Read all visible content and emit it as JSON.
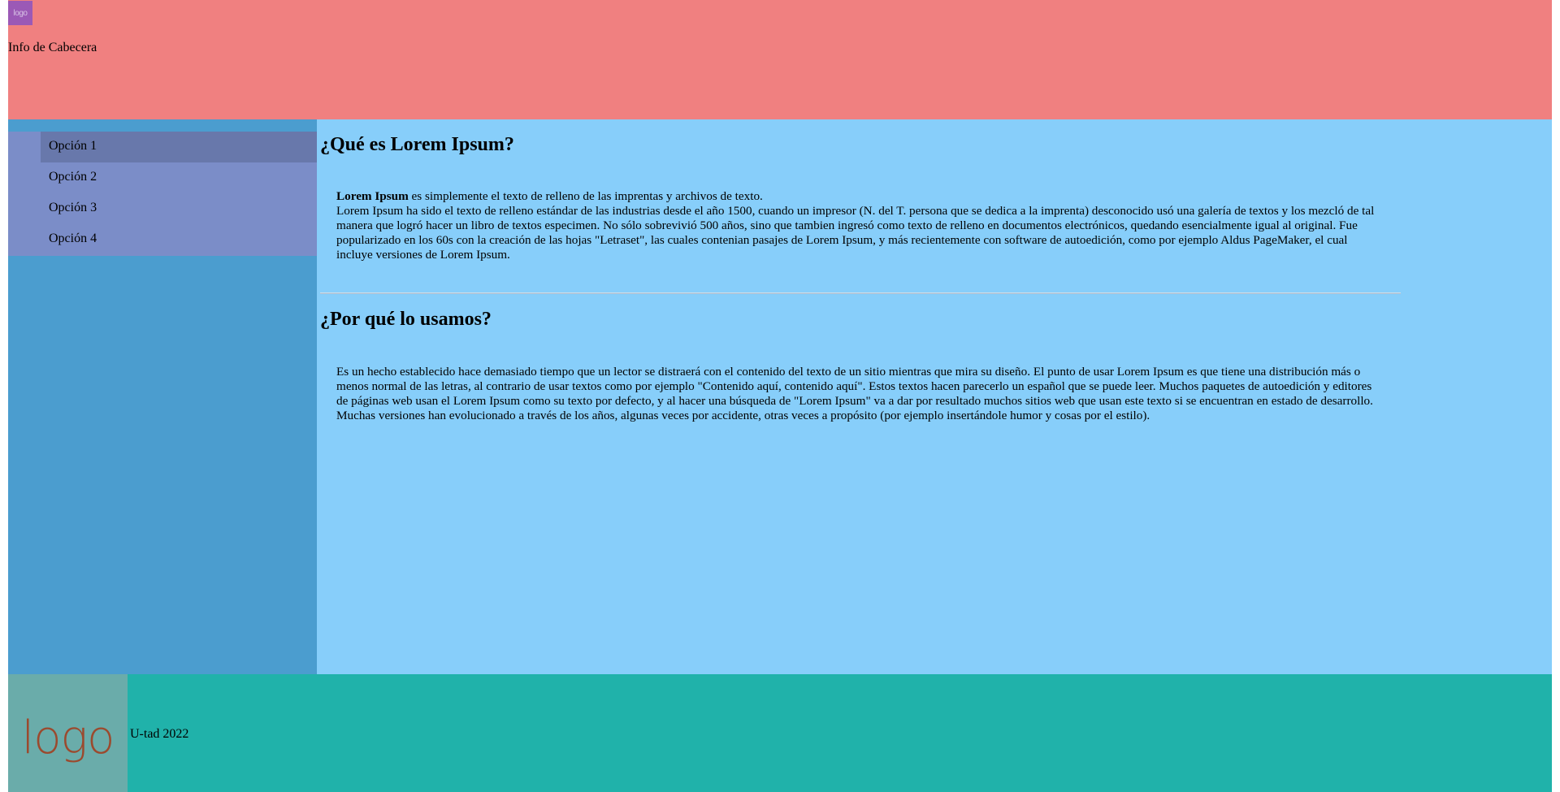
{
  "header": {
    "logo_text": "logo",
    "info": "Info de Cabecera"
  },
  "sidebar": {
    "items": [
      {
        "label": "Opción 1",
        "active": true
      },
      {
        "label": "Opción 2",
        "active": false
      },
      {
        "label": "Opción 3",
        "active": false
      },
      {
        "label": "Opción 4",
        "active": false
      }
    ]
  },
  "main": {
    "section1": {
      "title": "¿Qué es Lorem Ipsum?",
      "lead_bold": "Lorem Ipsum",
      "lead_rest": " es simplemente el texto de relleno de las imprentas y archivos de texto.",
      "body": "Lorem Ipsum ha sido el texto de relleno estándar de las industrias desde el año 1500, cuando un impresor (N. del T. persona que se dedica a la imprenta) desconocido usó una galería de textos y los mezcló de tal manera que logró hacer un libro de textos especimen. No sólo sobrevivió 500 años, sino que tambien ingresó como texto de relleno en documentos electrónicos, quedando esencialmente igual al original. Fue popularizado en los 60s con la creación de las hojas \"Letraset\", las cuales contenian pasajes de Lorem Ipsum, y más recientemente con software de autoedición, como por ejemplo Aldus PageMaker, el cual incluye versiones de Lorem Ipsum."
    },
    "section2": {
      "title": "¿Por qué lo usamos?",
      "body": "Es un hecho establecido hace demasiado tiempo que un lector se distraerá con el contenido del texto de un sitio mientras que mira su diseño. El punto de usar Lorem Ipsum es que tiene una distribución más o menos normal de las letras, al contrario de usar textos como por ejemplo \"Contenido aquí, contenido aquí\". Estos textos hacen parecerlo un español que se puede leer. Muchos paquetes de autoedición y editores de páginas web usan el Lorem Ipsum como su texto por defecto, y al hacer una búsqueda de \"Lorem Ipsum\" va a dar por resultado muchos sitios web que usan este texto si se encuentran en estado de desarrollo. Muchas versiones han evolucionado a través de los años, algunas veces por accidente, otras veces a propósito (por ejemplo insertándole humor y cosas por el estilo)."
    }
  },
  "footer": {
    "logo_text": "logo",
    "text": "U-tad 2022"
  },
  "colors": {
    "header": "#f08080",
    "sidebar": "#4b9dcf",
    "nav": "#7b8dc8",
    "nav_active": "#6878ab",
    "main": "#87cefa",
    "footer": "#20b2aa",
    "footer_logo_bg": "#6aacaa",
    "header_logo_bg": "#9b59b6"
  }
}
